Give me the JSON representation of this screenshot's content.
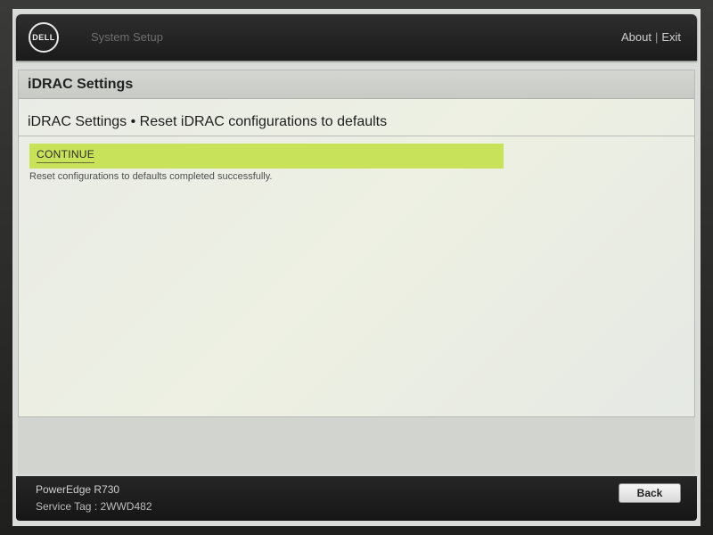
{
  "header": {
    "logo_text": "DELL",
    "app_title": "System Setup",
    "about_label": "About",
    "separator": "|",
    "exit_label": "Exit"
  },
  "panel": {
    "title": "iDRAC Settings",
    "subtitle": "iDRAC Settings • Reset iDRAC configurations to defaults",
    "continue_label": "CONTINUE",
    "status_message": "Reset configurations to defaults completed successfully."
  },
  "footer": {
    "model": "PowerEdge R730",
    "service_tag": "Service Tag : 2WWD482",
    "back_label": "Back"
  },
  "colors": {
    "header_bg": "#1b1b1b",
    "continue_highlight": "#c8e25a",
    "panel_bg": "#e9ebe6",
    "footer_bg": "#161616"
  }
}
